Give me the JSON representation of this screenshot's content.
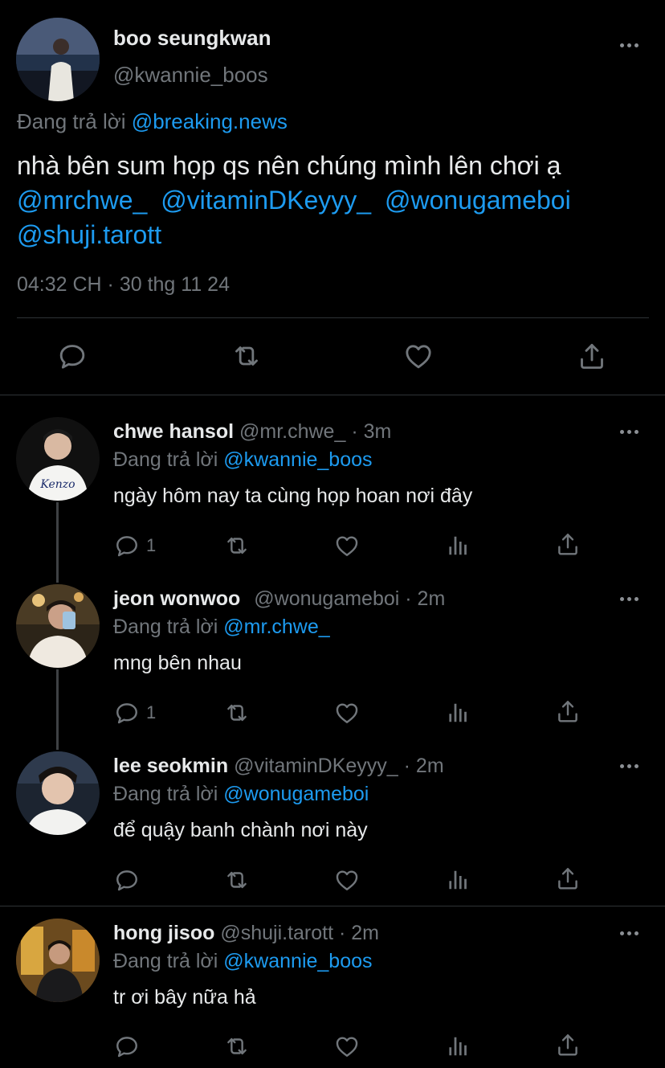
{
  "main_tweet": {
    "display_name": "boo seungkwan",
    "handle": "@kwannie_boos",
    "replying_label": "Đang trả lời",
    "replying_to": "@breaking.news",
    "text": "nhà bên sum họp qs nên chúng mình lên chơi ạ",
    "mentions": [
      "@mrchwe_",
      "@vitaminDKeyyy_",
      "@wonugameboi",
      "@shuji.tarott"
    ],
    "timestamp": "04:32 CH · 30 thg 11 24",
    "actions": [
      "reply-icon",
      "retweet-icon",
      "like-icon",
      "share-icon"
    ]
  },
  "replies": [
    {
      "display_name": "chwe hansol",
      "handle": "@mr.chwe_",
      "time": "· 3m",
      "replying_label": "Đang trả lời",
      "replying_to": "@kwannie_boos",
      "text": "ngày hôm nay ta cùng họp hoan nơi đây",
      "reply_count": "1"
    },
    {
      "display_name": "jeon wonwoo",
      "handle": "@wonugameboi",
      "time": "· 2m",
      "replying_label": "Đang trả lời",
      "replying_to": "@mr.chwe_",
      "text": "mng bên nhau",
      "reply_count": "1"
    },
    {
      "display_name": "lee seokmin",
      "handle": "@vitaminDKeyyy_",
      "time": "· 2m",
      "replying_label": "Đang trả lời",
      "replying_to": "@wonugameboi",
      "text": "để quậy banh chành nơi này",
      "reply_count": ""
    },
    {
      "display_name": "hong jisoo",
      "handle": "@shuji.tarott",
      "time": "· 2m",
      "replying_label": "Đang trả lời",
      "replying_to": "@kwannie_boos",
      "text": "tr ơi bây nữa hả",
      "reply_count": ""
    }
  ],
  "colors": {
    "background": "#000000",
    "text": "#e7e9ea",
    "muted": "#71767b",
    "link": "#1d9bf0",
    "divider": "#2f3336"
  }
}
